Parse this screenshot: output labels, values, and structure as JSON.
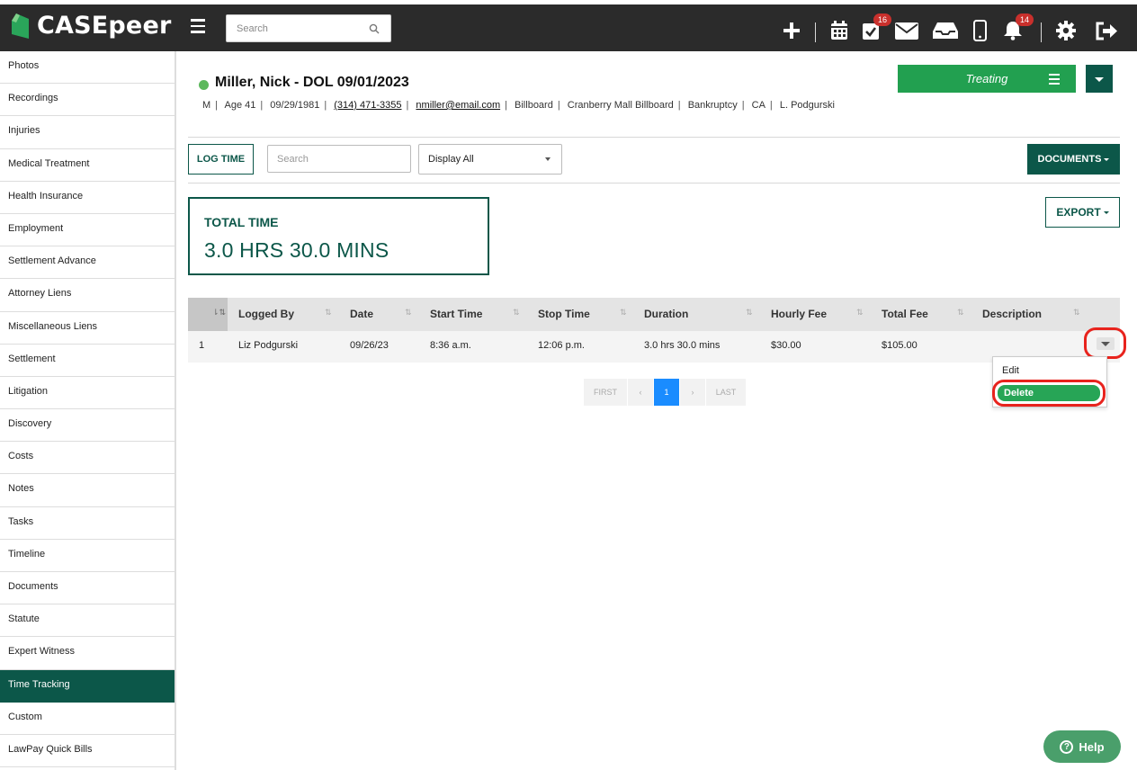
{
  "app": {
    "logo_text": "CASEpeer",
    "search_placeholder": "Search",
    "badges": {
      "tasks": "16",
      "notifications": "14"
    }
  },
  "sidebar": {
    "items": [
      {
        "label": "Photos"
      },
      {
        "label": "Recordings"
      },
      {
        "label": "Injuries"
      },
      {
        "label": "Medical Treatment"
      },
      {
        "label": "Health Insurance"
      },
      {
        "label": "Employment"
      },
      {
        "label": "Settlement Advance"
      },
      {
        "label": "Attorney Liens"
      },
      {
        "label": "Miscellaneous Liens"
      },
      {
        "label": "Settlement"
      },
      {
        "label": "Litigation"
      },
      {
        "label": "Discovery"
      },
      {
        "label": "Costs"
      },
      {
        "label": "Notes"
      },
      {
        "label": "Tasks"
      },
      {
        "label": "Timeline"
      },
      {
        "label": "Documents"
      },
      {
        "label": "Statute"
      },
      {
        "label": "Expert Witness"
      },
      {
        "label": "Time Tracking",
        "active": true
      },
      {
        "label": "Custom"
      },
      {
        "label": "LawPay Quick Bills"
      }
    ]
  },
  "client": {
    "name": "Miller, Nick - DOL 09/01/2023",
    "status_color": "#5cb85c",
    "meta": {
      "gender": "M",
      "age": "Age 41",
      "dob": "09/29/1981",
      "phone": "(314) 471-3355",
      "email": "nmiller@email.com",
      "source": "Billboard",
      "source_detail": "Cranberry Mall Billboard",
      "case_type": "Bankruptcy",
      "state": "CA",
      "attorney": "L. Podgurski"
    }
  },
  "case_status": {
    "label": "Treating",
    "color": "#22a050"
  },
  "toolbar": {
    "log_time_label": "LOG TIME",
    "search_placeholder": "Search",
    "display_value": "Display All",
    "documents_label": "DOCUMENTS",
    "export_label": "EXPORT"
  },
  "total": {
    "label": "TOTAL TIME",
    "value": "3.0 HRS 30.0 MINS"
  },
  "table": {
    "columns": [
      "Logged By",
      "Date",
      "Start Time",
      "Stop Time",
      "Duration",
      "Hourly Fee",
      "Total Fee",
      "Description"
    ],
    "rows": [
      {
        "index": "1",
        "logged_by": "Liz Podgurski",
        "date": "09/26/23",
        "start_time": "8:36 a.m.",
        "stop_time": "12:06 p.m.",
        "duration": "3.0 hrs 30.0 mins",
        "hourly_fee": "$30.00",
        "total_fee": "$105.00",
        "description": ""
      }
    ]
  },
  "pagination": {
    "first": "FIRST",
    "prev": "‹",
    "current": "1",
    "next": "›",
    "last": "LAST"
  },
  "row_menu": {
    "edit": "Edit",
    "delete": "Delete"
  },
  "help": {
    "label": "Help"
  },
  "colors": {
    "brand_dark": "#0c5749",
    "brand_green": "#22a050",
    "highlight_red": "#e8231d",
    "pager_active": "#1a8cff"
  }
}
